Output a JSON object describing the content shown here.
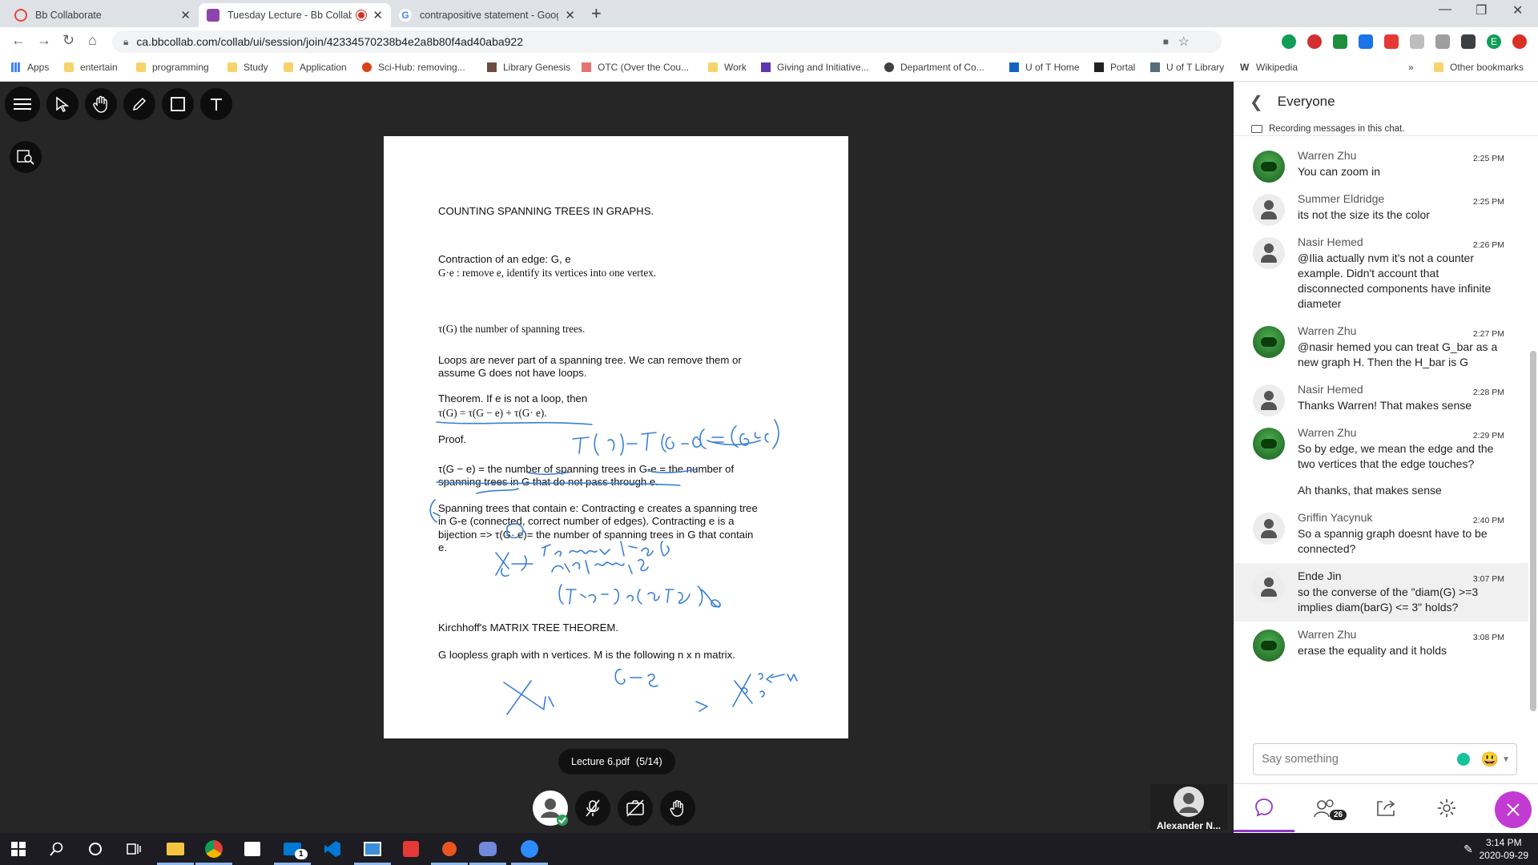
{
  "browser": {
    "tabs": [
      {
        "title": "Bb Collaborate",
        "color": "#e8453c"
      },
      {
        "title": "Tuesday Lecture - Bb Collab...",
        "color": "#8e44ad"
      },
      {
        "title": "contrapositive statement - Goog...",
        "color": "#4285f4"
      }
    ],
    "url": "ca.bbcollab.com/collab/ui/session/join/42334570238b4e2a8b80f4ad40aba922",
    "bookmarks": [
      "Apps",
      "entertain",
      "programming",
      "Study",
      "Application",
      "Sci-Hub: removing...",
      "Library Genesis",
      "OTC (Over the Cou...",
      "Work",
      "Giving and Initiative...",
      "Department of Co...",
      "U of T Home",
      "Portal",
      "U of T Library",
      "Wikipedia"
    ],
    "other_bookmarks": "Other bookmarks",
    "profile_initial": "E"
  },
  "document": {
    "lines": [
      "COUNTING SPANNING TREES IN GRAPHS.",
      "Contraction of an edge: G, e",
      "G·e  : remove e, identify its vertices into one vertex.",
      "τ(G) the number of spanning trees.",
      "Loops are never part of a spanning tree. We can remove them or",
      "assume G does not have loops.",
      "Theorem. If e is not a loop, then",
      "τ(G) = τ(G − e) + τ(G· e).",
      "Proof.",
      "τ(G − e) = the number of spanning trees in G-e = the number of",
      "spanning trees in G that do not pass through e.",
      "Spanning trees that contain e: Contracting e creates a spanning tree",
      "in G-e (connected, correct number of edges). Contracting e is a",
      "bijection => τ(G· e)= the number of spanning trees in G that contain",
      "e.",
      "Kirchhoff's MATRIX TREE THEOREM.",
      "G loopless graph with n vertices. M is the following n x n matrix."
    ],
    "file_label": "Lecture 6.pdf",
    "page_label": "(5/14)"
  },
  "presenter": {
    "name": "Alexander N..."
  },
  "chat": {
    "header": "Everyone",
    "recording_note": "Recording messages in this chat.",
    "messages": [
      {
        "name": "Warren Zhu",
        "time": "2:25 PM",
        "text": "You can zoom in",
        "avatar": "frog"
      },
      {
        "name": "Summer Eldridge",
        "time": "2:25 PM",
        "text": "its not the size its the color",
        "avatar": "gray"
      },
      {
        "name": "Nasir Hemed",
        "time": "2:26 PM",
        "text": "@Ilia actually nvm it's not a counter example. Didn't account that disconnected components have infinite diameter",
        "avatar": "gray"
      },
      {
        "name": "Warren Zhu",
        "time": "2:27 PM",
        "text": "@nasir hemed you can treat G_bar as a new graph H. Then the H_bar is G",
        "avatar": "frog"
      },
      {
        "name": "Nasir Hemed",
        "time": "2:28 PM",
        "text": "Thanks Warren! That makes sense",
        "avatar": "gray"
      },
      {
        "name": "Warren Zhu",
        "time": "2:29 PM",
        "text": "So by edge, we mean the edge and the two vertices that the edge touches?",
        "text2": "Ah thanks, that makes sense",
        "avatar": "frog"
      },
      {
        "name": "Griffin Yacynuk",
        "time": "2:40 PM",
        "text": "So a spannig graph doesnt have to be connected?",
        "avatar": "gray"
      },
      {
        "name": "Ende Jin",
        "time": "3:07 PM",
        "text": "so the converse of the \"diam(G) >=3 implies diam(barG) <= 3\" holds?",
        "avatar": "gray",
        "highlight": true
      },
      {
        "name": "Warren Zhu",
        "time": "3:08 PM",
        "text": "erase the equality and it holds",
        "avatar": "frog"
      }
    ],
    "input_placeholder": "Say something",
    "attendee_count": "26"
  },
  "taskbar": {
    "time": "3:14 PM",
    "date": "2020-09-29",
    "mail_badge": "1"
  }
}
